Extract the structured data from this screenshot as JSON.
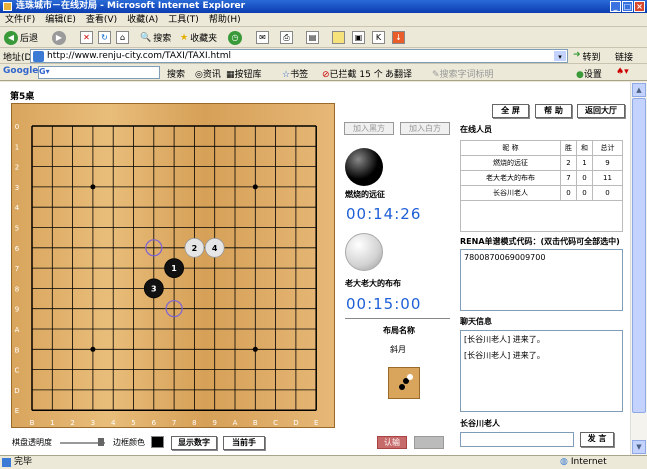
{
  "window": {
    "title": "连珠城市－在线对局 - Microsoft Internet Explorer"
  },
  "menu": [
    "文件(F)",
    "编辑(E)",
    "查看(V)",
    "收藏(A)",
    "工具(T)",
    "帮助(H)"
  ],
  "toolbar": {
    "back": "后退",
    "search": "搜索",
    "favorites": "收藏夹"
  },
  "address": {
    "label": "地址(D)",
    "url": "http://www.renju-city.com/TAXI/TAXI.html",
    "go": "转到",
    "links": "链接"
  },
  "google_bar": {
    "search": "搜索",
    "news": "资讯",
    "tools": "按钮库",
    "bookmarks": "书签",
    "blocked": "已拦截 15 个",
    "translate": "翻译",
    "placeholder": "搜索字词标明",
    "settings": "设置"
  },
  "game": {
    "table_label": "第5桌",
    "top_buttons": [
      "全 屏",
      "帮 助",
      "返回大厅"
    ],
    "add_black": "加入黑方",
    "add_white": "加入白方",
    "black_player": "燃烧的远征",
    "black_time": "00:14:26",
    "white_player": "老大老大的布布",
    "white_time": "00:15:00",
    "opening_label": "布局名称",
    "opening_name": "斜月",
    "online_label": "在线人员",
    "players_header": [
      "昵 称",
      "胜",
      "和",
      "总计"
    ],
    "players": [
      [
        "燃烧的远征",
        "2",
        "1",
        "9"
      ],
      [
        "老大老大的布布",
        "7",
        "0",
        "11"
      ],
      [
        "长谷川老人",
        "0",
        "0",
        "0"
      ]
    ],
    "renju_code_label": "RENA单谱模式代码：(双击代码可全部选中)",
    "renju_code": "7800870069009700",
    "chat_label": "聊天信息",
    "chat_lines": [
      "[长谷川老人] 进来了。",
      "[长谷川老人] 进来了。"
    ],
    "chat_user": "长谷川老人",
    "send": "发 言",
    "board_transparency": "棋盘透明度",
    "border_color": "边框颜色",
    "show_numbers": "显示数字",
    "current_move": "当前手",
    "resign": "认输",
    "col_labels": [
      "B",
      "1",
      "2",
      "3",
      "4",
      "5",
      "6",
      "7",
      "8",
      "9",
      "A",
      "B",
      "C",
      "D",
      "E"
    ],
    "row_labels": [
      "0",
      "1",
      "2",
      "3",
      "4",
      "5",
      "6",
      "7",
      "8",
      "9",
      "A",
      "B",
      "C",
      "D",
      "E"
    ],
    "stones": [
      {
        "n": "1",
        "color": "black",
        "col": 7,
        "row": 7
      },
      {
        "n": "2",
        "color": "white",
        "col": 8,
        "row": 6
      },
      {
        "n": "3",
        "color": "black",
        "col": 6,
        "row": 8
      },
      {
        "n": "4",
        "color": "white",
        "col": 9,
        "row": 6
      }
    ],
    "candidates": [
      {
        "col": 6,
        "row": 6
      },
      {
        "col": 7,
        "row": 9
      }
    ],
    "star_points": [
      {
        "col": 3,
        "row": 3
      },
      {
        "col": 11,
        "row": 3
      },
      {
        "col": 7,
        "row": 7
      },
      {
        "col": 3,
        "row": 11
      },
      {
        "col": 11,
        "row": 11
      }
    ]
  },
  "status": {
    "done": "完毕",
    "zone": "Internet"
  }
}
